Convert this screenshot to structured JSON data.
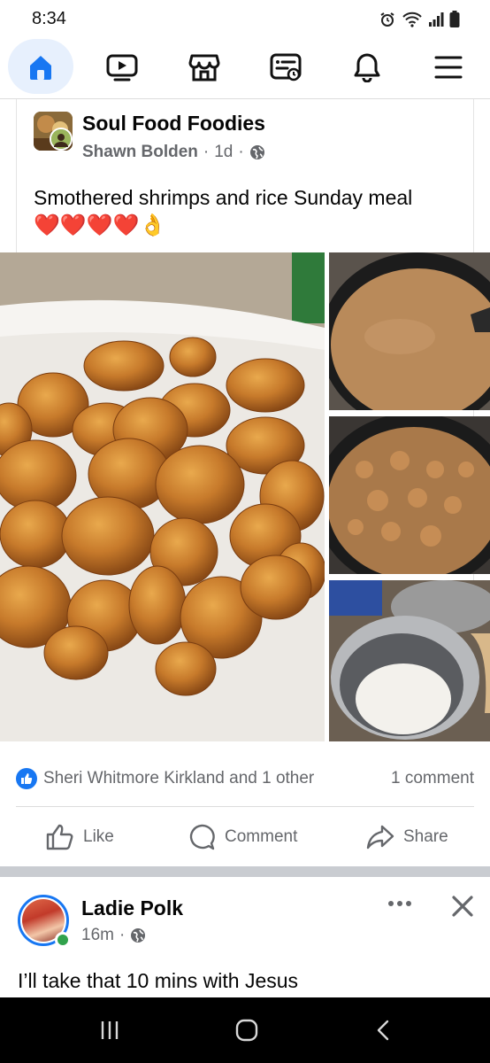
{
  "status_bar": {
    "time": "8:34",
    "icons": [
      "alarm-icon",
      "wifi-icon",
      "signal-icon",
      "battery-icon"
    ]
  },
  "nav": {
    "items": [
      {
        "name": "home-icon",
        "active": true
      },
      {
        "name": "video-icon",
        "active": false
      },
      {
        "name": "marketplace-icon",
        "active": false
      },
      {
        "name": "feeds-icon",
        "active": false
      },
      {
        "name": "notifications-icon",
        "active": false
      },
      {
        "name": "menu-icon",
        "active": false
      }
    ],
    "active_color": "#1877f2"
  },
  "post1": {
    "group_name": "Soul Food Foodies",
    "author": "Shawn Bolden",
    "separator": "·",
    "time": "1d",
    "privacy_icon": "globe-icon",
    "text": "Smothered shrimps and rice Sunday meal",
    "emojis": "❤️❤️❤️❤️👌",
    "photos": [
      "fried-shrimp-photo",
      "gravy-pan-photo",
      "shrimp-gravy-photo",
      "rice-cooker-photo"
    ],
    "reactions_text": "Sheri Whitmore Kirkland and 1 other",
    "comments_text": "1 comment",
    "actions": {
      "like": "Like",
      "comment": "Comment",
      "share": "Share"
    }
  },
  "post2": {
    "author": "Ladie Polk",
    "time": "16m",
    "separator": "·",
    "privacy_icon": "globe-icon",
    "text": "I’ll take that 10 mins with Jesus"
  },
  "colors": {
    "brand": "#1877f2",
    "secondary_text": "#65676b",
    "online": "#31a24c"
  }
}
